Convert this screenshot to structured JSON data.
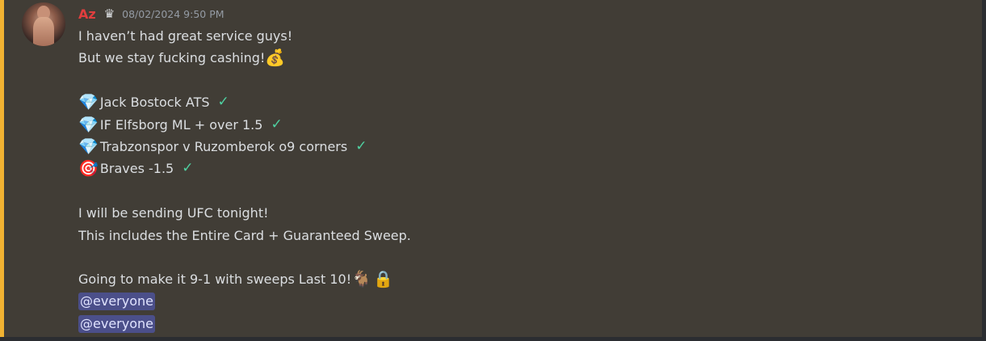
{
  "author": {
    "name": "Az",
    "badge_icon": "crown-icon",
    "timestamp": "08/02/2024 9:50 PM"
  },
  "message": {
    "intro_1": "I haven’t had great service guys!",
    "intro_2": "But we stay fucking cashing!",
    "picks": [
      {
        "icon": "gem-icon",
        "text": "Jack Bostock ATS",
        "status": "check-icon"
      },
      {
        "icon": "gem-icon",
        "text": "IF Elfsborg ML + over 1.5",
        "status": "check-icon"
      },
      {
        "icon": "gem-icon",
        "text": "Trabzonspor v Ruzomberok o9 corners",
        "status": "check-icon"
      },
      {
        "icon": "target-icon",
        "text": "Braves -1.5",
        "status": "check-icon"
      }
    ],
    "ufc_1": "I will be sending UFC tonight!",
    "ufc_2": "This includes the Entire Card + Guaranteed Sweep.",
    "closing": "Going to make it 9-1 with sweeps Last 10!",
    "mentions": [
      "@everyone",
      "@everyone"
    ]
  },
  "colors": {
    "username": "#e03e3e",
    "accent_bar": "#f0b232",
    "mention_bg": "#5865f2",
    "check": "#4fd1a1"
  }
}
